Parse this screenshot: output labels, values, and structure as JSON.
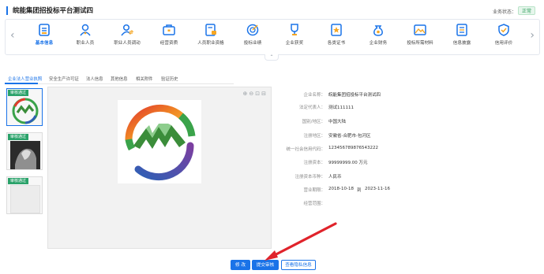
{
  "header": {
    "title": "皖能集团招投标平台测试四",
    "status_label": "业务状态：",
    "status_value": "正常",
    "status_color": "#2e9d5b"
  },
  "nav": {
    "prev_icon": "chevron-left-icon",
    "next_icon": "chevron-right-icon",
    "collapse_icon": "chevron-up-icon",
    "items": [
      {
        "label": "基本信息",
        "icon": "basic-info-icon",
        "active": true
      },
      {
        "label": "职业人员",
        "icon": "person-icon",
        "active": false
      },
      {
        "label": "职业人员调动",
        "icon": "person-transfer-icon",
        "active": false
      },
      {
        "label": "经营资质",
        "icon": "briefcase-icon",
        "active": false
      },
      {
        "label": "人员职业资格",
        "icon": "certificate-lock-icon",
        "active": false
      },
      {
        "label": "投标业绩",
        "icon": "target-icon",
        "active": false
      },
      {
        "label": "企业获奖",
        "icon": "trophy-icon",
        "active": false
      },
      {
        "label": "各类证书",
        "icon": "document-star-icon",
        "active": false
      },
      {
        "label": "企业财务",
        "icon": "money-bag-icon",
        "active": false
      },
      {
        "label": "投标所需材料",
        "icon": "image-file-icon",
        "active": false
      },
      {
        "label": "信息披露",
        "icon": "list-icon",
        "active": false
      },
      {
        "label": "信用评价",
        "icon": "shield-check-icon",
        "active": false
      }
    ]
  },
  "tabs": [
    {
      "label": "企业法人营业执照",
      "active": true
    },
    {
      "label": "安全生产许可证",
      "active": false
    },
    {
      "label": "法人信息",
      "active": false
    },
    {
      "label": "其他信息",
      "active": false
    },
    {
      "label": "相关附件",
      "active": false
    },
    {
      "label": "验证历史",
      "active": false
    }
  ],
  "thumbnails": [
    {
      "badge": "审核通过",
      "image": "company-logo",
      "selected": true
    },
    {
      "badge": "审核通过",
      "image": "photo",
      "selected": false
    },
    {
      "badge": "审核通过",
      "image": "blank",
      "selected": false
    }
  ],
  "viewer": {
    "tools": [
      "zoom-in-icon",
      "zoom-out-icon",
      "fit-icon",
      "rotate-icon"
    ]
  },
  "info": {
    "company_name_label": "企业名称：",
    "company_name": "皖能集团招投标平台测试四",
    "legal_rep_label": "法定代表人：",
    "legal_rep": "测试111111",
    "region_label": "国别/地区：",
    "region": "中国大陆",
    "reg_area_label": "注册地区：",
    "reg_area": "安徽省-合肥市-包河区",
    "credit_code_label": "统一社会信用代码：",
    "credit_code": "123456789876543222",
    "capital_label": "注册资本：",
    "capital": "99999999.00 万元",
    "currency_label": "注册资本币种：",
    "currency": "人民币",
    "term_label": "营业期限：",
    "term_start": "2018-10-18",
    "term_sep": "到",
    "term_end": "2023-11-16",
    "scope_label": "经营范围：",
    "scope": ""
  },
  "actions": {
    "edit": "修 改",
    "submit": "提交审核",
    "view_private": "查看隐私信息"
  },
  "colors": {
    "accent": "#1a73e8",
    "approved_badge": "#2aa26a",
    "annotation_arrow": "#e0232b"
  }
}
